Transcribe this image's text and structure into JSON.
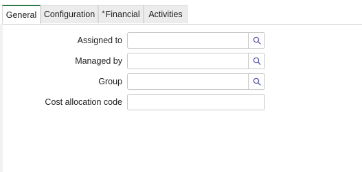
{
  "tabs": [
    {
      "label": "General",
      "active": true
    },
    {
      "label": "Configuration",
      "active": false
    },
    {
      "label": "Financial",
      "required_marker": "*",
      "active": false
    },
    {
      "label": "Activities",
      "active": false
    }
  ],
  "form": {
    "assigned_to": {
      "label": "Assigned to",
      "value": ""
    },
    "managed_by": {
      "label": "Managed by",
      "value": ""
    },
    "group": {
      "label": "Group",
      "value": ""
    },
    "cost_allocation_code": {
      "label": "Cost allocation code",
      "value": ""
    }
  },
  "icons": {
    "lookup": "search-icon"
  },
  "colors": {
    "active_tab_accent": "#2b7a4b",
    "search_icon": "#5a5aa8"
  }
}
